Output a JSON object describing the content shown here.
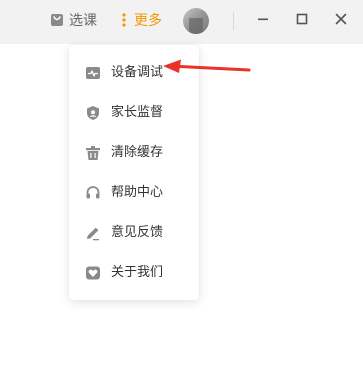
{
  "topbar": {
    "select_label": "选课",
    "more_label": "更多",
    "select_icon": "bag-icon",
    "more_icon": "vertical-dots-icon",
    "accent_color": "#f39800"
  },
  "window_controls": {
    "minimize_icon": "minimize-icon",
    "maximize_icon": "maximize-icon",
    "close_icon": "close-icon"
  },
  "menu": {
    "items": [
      {
        "label": "设备调试",
        "icon": "device-debug-icon"
      },
      {
        "label": "家长监督",
        "icon": "shield-icon"
      },
      {
        "label": "清除缓存",
        "icon": "trash-icon"
      },
      {
        "label": "帮助中心",
        "icon": "headset-icon"
      },
      {
        "label": "意见反馈",
        "icon": "pencil-icon"
      },
      {
        "label": "关于我们",
        "icon": "about-heart-icon"
      }
    ]
  },
  "annotation": {
    "arrow_color": "#e8322a"
  }
}
